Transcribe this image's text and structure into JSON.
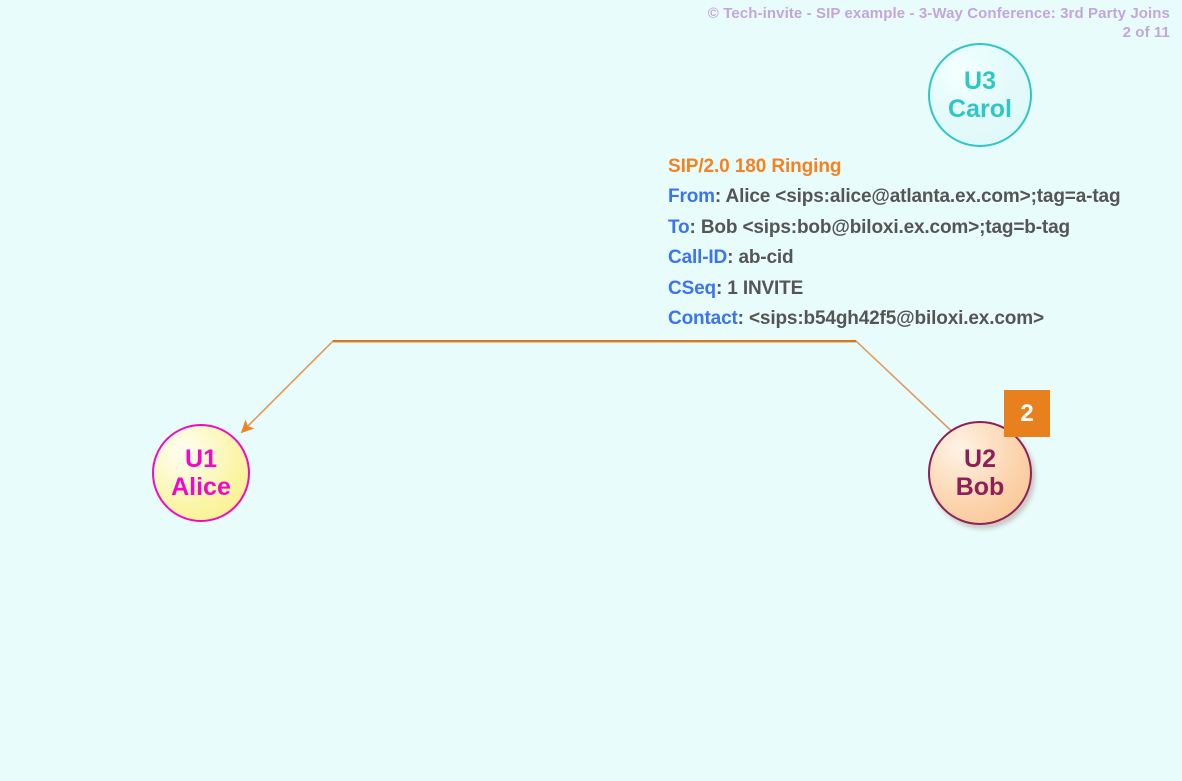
{
  "header": {
    "copyright_line": "© Tech-invite - SIP example - 3-Way Conference: 3rd Party Joins",
    "page_indicator": "2 of 11",
    "color": "#c3a6dc"
  },
  "actors": [
    {
      "id": "U1",
      "line1": "U1",
      "line2": "Alice",
      "border_color": "#f209c7",
      "text_color": "#f209c7",
      "fill_color": "#f9ef7e"
    },
    {
      "id": "U2",
      "line1": "U2",
      "line2": "Bob",
      "border_color": "#8c2059",
      "text_color": "#8c2059",
      "fill_color": "#f8c28e"
    },
    {
      "id": "U3",
      "line1": "U3",
      "line2": "Carol",
      "border_color": "#2ec6c6",
      "text_color": "#2ec6c6",
      "fill_color": "#e6fbfb"
    }
  ],
  "step_badge": {
    "number": "2",
    "background": "#e8801e",
    "text_color": "#ffffff"
  },
  "message": {
    "status_line": "SIP/2.0 180 Ringing",
    "status_color": "#f5821f",
    "header_color": "#3b74ef",
    "value_color": "#555555",
    "headers": [
      {
        "name": "From",
        "separator": ": ",
        "value": "Alice <sips:alice@atlanta.ex.com>;tag=a-tag"
      },
      {
        "name": "To",
        "separator": ": ",
        "value": "Bob <sips:bob@biloxi.ex.com>;tag=b-tag"
      },
      {
        "name": "Call-ID",
        "separator": ": ",
        "value": "ab-cid"
      },
      {
        "name": "CSeq",
        "separator": ": ",
        "value": "1 INVITE"
      },
      {
        "name": "Contact",
        "separator": ": ",
        "value": "<sips:b54gh42f5@biloxi.ex.com>"
      }
    ]
  },
  "arrow": {
    "color": "#e0803a",
    "direction": "from U2 Bob to U1 Alice",
    "label": "180-ringing-arrow"
  }
}
